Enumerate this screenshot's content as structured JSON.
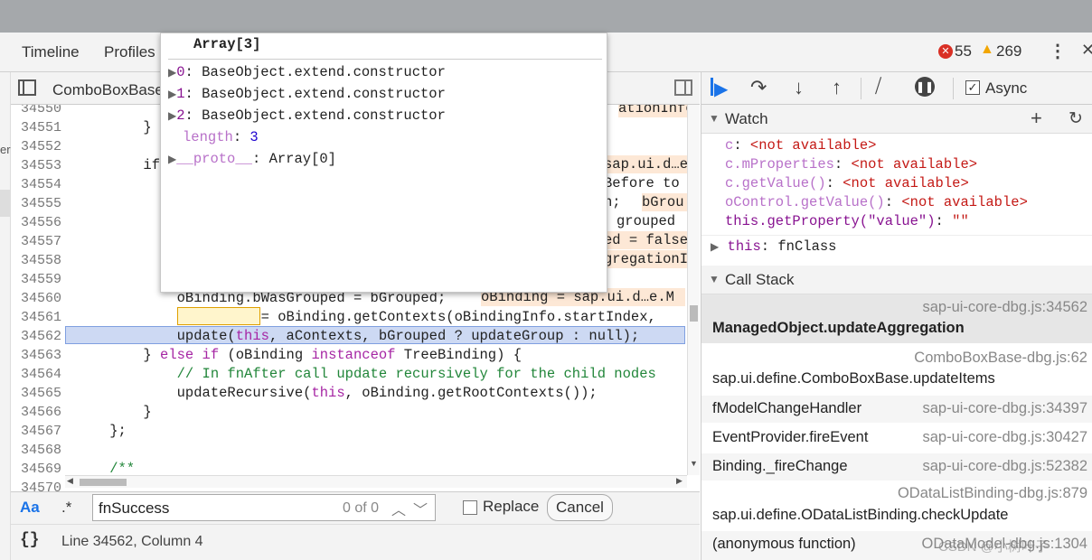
{
  "tabs": {
    "timeline": "Timeline",
    "profiles": "Profiles"
  },
  "counts": {
    "errors": "55",
    "warnings": "269"
  },
  "editor": {
    "file_tab": "ComboBoxBase",
    "lines": [
      {
        "n": "34550",
        "code": ""
      },
      {
        "n": "34551",
        "code": "        }"
      },
      {
        "n": "34552",
        "code": ""
      },
      {
        "n": "34553",
        "code": "        if"
      },
      {
        "n": "34554",
        "code": ""
      },
      {
        "n": "34555",
        "code": ""
      },
      {
        "n": "34556",
        "code": ""
      },
      {
        "n": "34557",
        "code": ""
      },
      {
        "n": "34558",
        "code": ""
      },
      {
        "n": "34559",
        "code": ""
      },
      {
        "n": "34560",
        "code": "            oBinding.bWasGrouped = bGrouped;"
      },
      {
        "n": "34561",
        "code": "            aContexts = oBinding.getContexts(oBindingInfo.startIndex,"
      },
      {
        "n": "34562",
        "code": "            update(this, aContexts, bGrouped ? updateGroup : null);"
      },
      {
        "n": "34563",
        "code": "        } else if (oBinding instanceof TreeBinding) {"
      },
      {
        "n": "34564",
        "code": "            // In fnAfter call update recursively for the child nodes"
      },
      {
        "n": "34565",
        "code": "            updateRecursive(this, oBinding.getRootContexts());"
      },
      {
        "n": "34566",
        "code": "        }"
      },
      {
        "n": "34567",
        "code": "    };"
      },
      {
        "n": "34568",
        "code": ""
      },
      {
        "n": "34569",
        "code": "    /**"
      },
      {
        "n": "34570",
        "code": ""
      }
    ],
    "inline_values": {
      "v34550": "ationInfo",
      "v34553": "sap.ui.d…e",
      "v34554": "Before to",
      "v34555a": "n;",
      "v34555b": "bGrou",
      "v34556": "grouped",
      "v34557": "ed = false",
      "v34558": "gregationI",
      "v34560": "oBinding = sap.ui.d…e.M"
    }
  },
  "popup": {
    "title": "Array[3]",
    "items": [
      {
        "key": "0",
        "value": "BaseObject.extend.constructor"
      },
      {
        "key": "1",
        "value": "BaseObject.extend.constructor"
      },
      {
        "key": "2",
        "value": "BaseObject.extend.constructor"
      }
    ],
    "length_key": "length",
    "length_value": "3",
    "proto_key": "__proto__",
    "proto_value": "Array[0]"
  },
  "find": {
    "aa_label": "Aa",
    "regex_label": ".*",
    "value": "fnSuccess",
    "match_count": "0 of 0",
    "replace_label": "Replace",
    "cancel_label": "Cancel"
  },
  "status": {
    "braces": "{}",
    "position": "Line 34562, Column 4"
  },
  "debugger": {
    "async_label": "Async"
  },
  "watch": {
    "title": "Watch",
    "items": [
      {
        "expr": "c",
        "value": "<not available>"
      },
      {
        "expr": "c.mProperties",
        "value": "<not available>"
      },
      {
        "expr": "c.getValue()",
        "value": "<not available>"
      },
      {
        "expr": "oControl.getValue()",
        "value": "<not available>"
      },
      {
        "expr": "this.getProperty(\"value\")",
        "value": "\"\""
      }
    ],
    "this_key": "this",
    "this_value": "fnClass"
  },
  "callstack": {
    "title": "Call Stack",
    "frames": [
      {
        "fn": "ManagedObject.updateAggregation",
        "file": "sap-ui-core-dbg.js:34562"
      },
      {
        "fn": "sap.ui.define.ComboBoxBase.updateItems",
        "file": "ComboBoxBase-dbg.js:62"
      },
      {
        "fn": "fModelChangeHandler",
        "file": "sap-ui-core-dbg.js:34397"
      },
      {
        "fn": "EventProvider.fireEvent",
        "file": "sap-ui-core-dbg.js:30427"
      },
      {
        "fn": "Binding._fireChange",
        "file": "sap-ui-core-dbg.js:52382"
      },
      {
        "fn": "sap.ui.define.ODataListBinding.checkUpdate",
        "file": "ODataListBinding-dbg.js:879"
      },
      {
        "fn": "(anonymous function)",
        "file": "ODataModel-dbg.js:1304"
      }
    ]
  },
  "watermark": "CSDN @小树叶子",
  "colors": {
    "accent": "#1a73e8",
    "error": "#c41a16",
    "keyword": "#a626a4",
    "comment": "#22863a",
    "highlight": "#cdd9f3"
  }
}
